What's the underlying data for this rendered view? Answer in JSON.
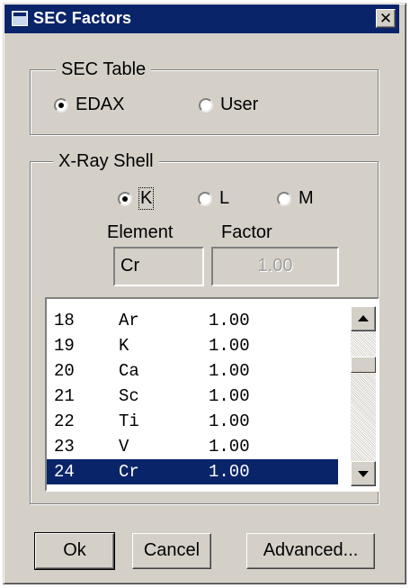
{
  "window": {
    "title": "SEC Factors",
    "close_label": "✕"
  },
  "sec_table": {
    "legend": "SEC Table",
    "options": [
      {
        "label": "EDAX",
        "checked": true
      },
      {
        "label": "User",
        "checked": false
      }
    ]
  },
  "xray_shell": {
    "legend": "X-Ray Shell",
    "options": [
      {
        "label": "K",
        "checked": true
      },
      {
        "label": "L",
        "checked": false
      },
      {
        "label": "M",
        "checked": false
      }
    ],
    "element_label": "Element",
    "factor_label": "Factor",
    "element_value": "Cr",
    "factor_value": "1.00"
  },
  "element_list": {
    "rows": [
      {
        "z": "18",
        "symbol": "Ar",
        "factor": "1.00",
        "selected": false
      },
      {
        "z": "19",
        "symbol": "K",
        "factor": "1.00",
        "selected": false
      },
      {
        "z": "20",
        "symbol": "Ca",
        "factor": "1.00",
        "selected": false
      },
      {
        "z": "21",
        "symbol": "Sc",
        "factor": "1.00",
        "selected": false
      },
      {
        "z": "22",
        "symbol": "Ti",
        "factor": "1.00",
        "selected": false
      },
      {
        "z": "23",
        "symbol": "V",
        "factor": "1.00",
        "selected": false
      },
      {
        "z": "24",
        "symbol": "Cr",
        "factor": "1.00",
        "selected": true
      }
    ]
  },
  "buttons": {
    "ok": "Ok",
    "cancel": "Cancel",
    "advanced": "Advanced..."
  },
  "colors": {
    "selection": "#0a246a",
    "face": "#d4d0c8"
  },
  "icons": {
    "title": "window-icon",
    "close": "close-icon",
    "scroll_up": "arrow-up-icon",
    "scroll_down": "arrow-down-icon"
  }
}
